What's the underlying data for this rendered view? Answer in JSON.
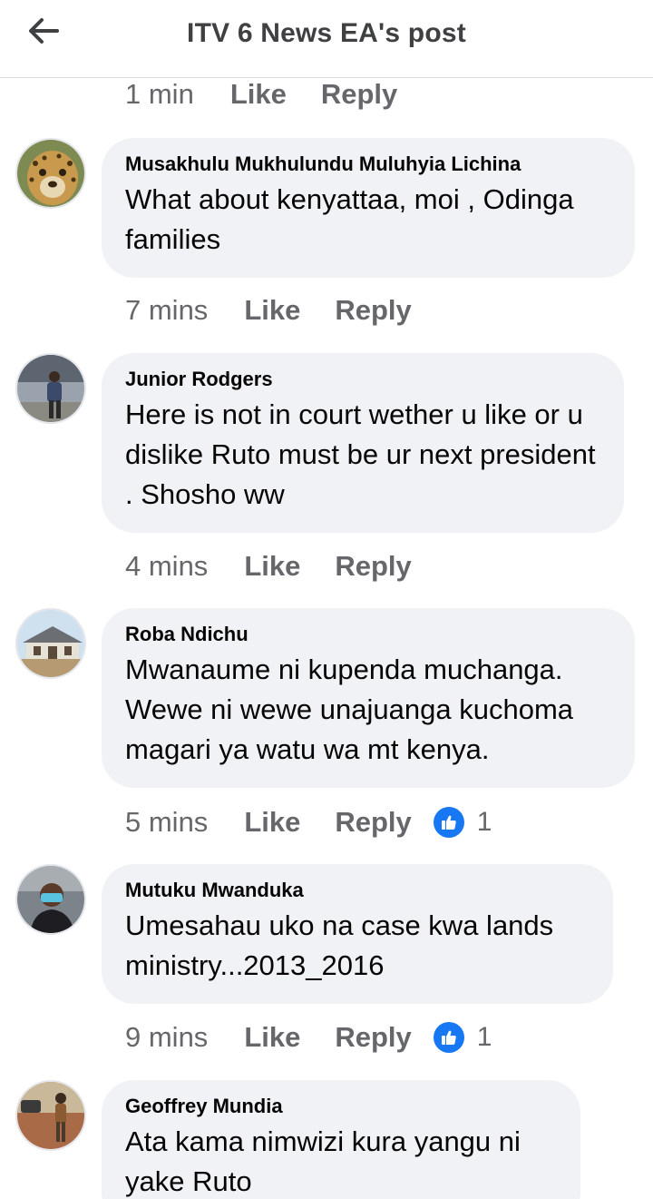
{
  "header": {
    "title": "ITV 6 News EA's post",
    "back_icon": "arrow-left-icon"
  },
  "top_meta": {
    "time": "1 min",
    "like": "Like",
    "reply": "Reply"
  },
  "comments": [
    {
      "author": "Musakhulu Mukhulundu Muluhyia Lichina",
      "text": "What about kenyattaa, moi ,  Odinga families",
      "time": "7 mins",
      "like": "Like",
      "reply": "Reply",
      "reactions": ""
    },
    {
      "author": "Junior Rodgers",
      "text": "Here is not in court wether u like or u dislike Ruto must be ur next president . Shosho ww",
      "time": "4 mins",
      "like": "Like",
      "reply": "Reply",
      "reactions": ""
    },
    {
      "author": "Roba Ndichu",
      "text": "Mwanaume ni kupenda muchanga. Wewe ni wewe unajuanga kuchoma magari ya watu wa mt kenya.",
      "time": "5 mins",
      "like": "Like",
      "reply": "Reply",
      "reactions": "1"
    },
    {
      "author": "Mutuku Mwanduka",
      "text": "Umesahau uko na case kwa lands ministry...2013_2016",
      "time": "9 mins",
      "like": "Like",
      "reply": "Reply",
      "reactions": "1"
    },
    {
      "author": "Geoffrey Mundia",
      "text": "Ata kama nimwizi kura yangu ni yake Ruto",
      "time": "",
      "like": "",
      "reply": "",
      "reactions": ""
    }
  ],
  "colors": {
    "link_gray": "#65676b",
    "bubble": "#f0f2f5",
    "like_blue": "#1877f2"
  }
}
